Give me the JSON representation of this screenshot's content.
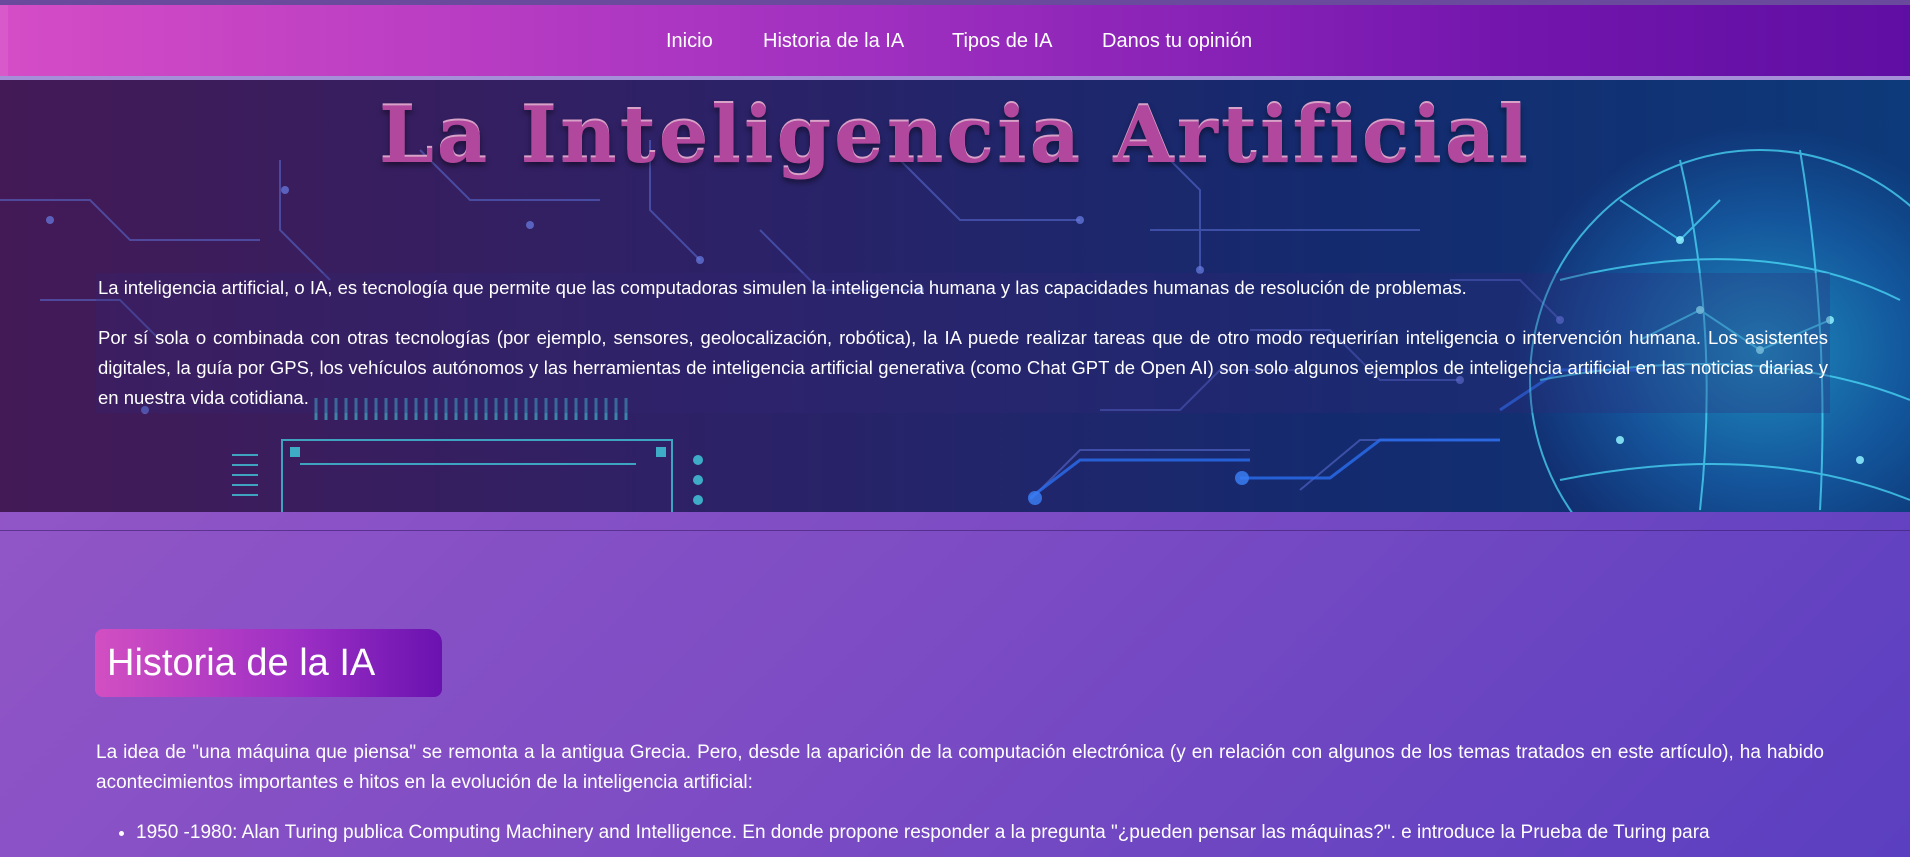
{
  "nav": {
    "items": [
      {
        "label": "Inicio"
      },
      {
        "label": "Historia de la IA"
      },
      {
        "label": "Tipos de IA"
      },
      {
        "label": "Danos tu opinión"
      }
    ]
  },
  "hero": {
    "title": "La Inteligencia Artificial",
    "paragraph1": "La inteligencia artificial, o IA, es tecnología que permite que las computadoras simulen la inteligencia humana y las capacidades humanas de resolución de problemas.",
    "paragraph2": "Por sí sola o combinada con otras tecnologías (por ejemplo, sensores, geolocalización, robótica), la IA puede realizar tareas que de otro modo requerirían inteligencia o intervención humana. Los asistentes digitales, la guía por GPS, los vehículos autónomos y las herramientas de inteligencia artificial generativa (como Chat GPT de Open AI) son solo algunos ejemplos de inteligencia artificial en las noticias diarias y en nuestra vida cotidiana."
  },
  "historia": {
    "title": "Historia de la IA",
    "intro": "La idea de \"una máquina que piensa\" se remonta a la antigua Grecia. Pero, desde la aparición de la computación electrónica (y en relación con algunos de los temas tratados en este artículo), ha habido acontecimientos importantes e hitos en la evolución de la inteligencia artificial:",
    "items": [
      "1950 -1980: Alan Turing publica Computing Machinery and Intelligence. En donde propone responder a la pregunta \"¿pueden pensar las máquinas?\". e introduce la Prueba de Turing para"
    ]
  }
}
